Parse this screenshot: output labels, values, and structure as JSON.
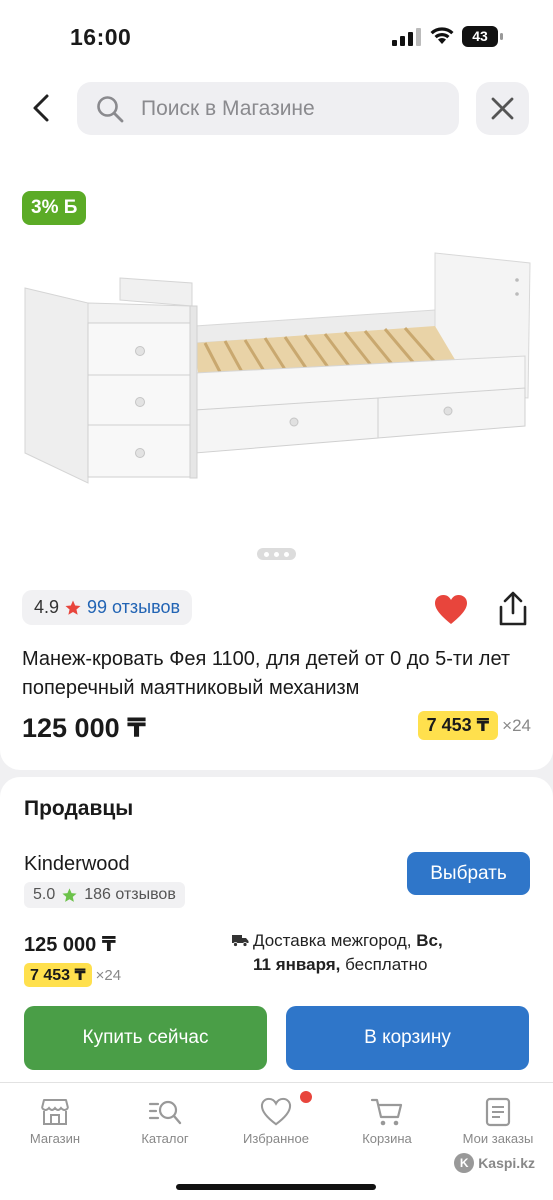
{
  "status_bar": {
    "time": "16:00",
    "battery": "43"
  },
  "header": {
    "search_placeholder": "Поиск в Магазине",
    "back_icon": "chevron-left-icon",
    "close_icon": "close-icon"
  },
  "product": {
    "cashback_badge": "3% Б",
    "image_icon": "crib-bed-image",
    "rating": "4.9",
    "reviews_label": "99 отзывов",
    "title": "Манеж-кровать Фея 1100, для детей от 0 до 5-ти лет поперечный маятниковый механизм",
    "price": "125 000 ₸",
    "installment_amount": "7 453 ₸",
    "installment_term": "×24",
    "favorited": true
  },
  "sellers": {
    "title": "Продавцы",
    "seller_name": "Kinderwood",
    "seller_rating": "5.0",
    "seller_reviews": "186 отзывов",
    "choose_label": "Выбрать",
    "price": "125 000 ₸",
    "installment_amount": "7 453 ₸",
    "installment_term": "×24",
    "delivery_prefix": "Доставка межгород, ",
    "delivery_day": "Вс,",
    "delivery_date": "11 января,",
    "delivery_suffix": " бесплатно",
    "buy_now_label": "Купить сейчас",
    "cart_label": "В корзину"
  },
  "tabbar": {
    "tabs": [
      {
        "label": "Магазин",
        "icon": "store-icon"
      },
      {
        "label": "Каталог",
        "icon": "catalog-search-icon"
      },
      {
        "label": "Избранное",
        "icon": "heart-icon"
      },
      {
        "label": "Корзина",
        "icon": "cart-icon"
      },
      {
        "label": "Мои заказы",
        "icon": "orders-icon"
      }
    ],
    "watermark": "Kaspi.kz"
  },
  "colors": {
    "accent_blue": "#2f76c9",
    "buy_green": "#4a9e47",
    "cashback_green": "#5bab26",
    "installment_yellow": "#ffe04d",
    "heart_red": "#e8453c"
  }
}
